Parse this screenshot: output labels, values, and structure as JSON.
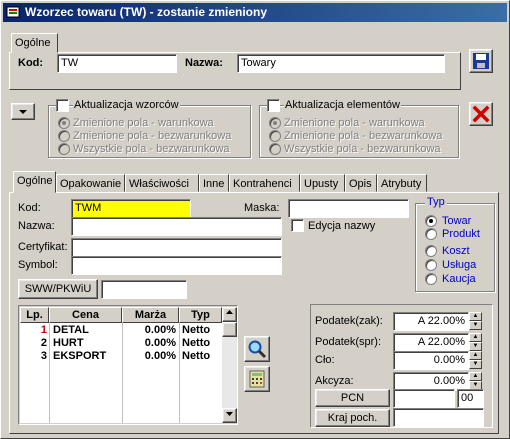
{
  "window": {
    "title": "Wzorzec towaru (TW) - zostanie zmieniony"
  },
  "top": {
    "tab_label": "Ogólne",
    "kod_label": "Kod:",
    "kod_value": "TW",
    "nazwa_label": "Nazwa:",
    "nazwa_value": "Towary"
  },
  "update": {
    "templates_label": "Aktualizacja wzorców",
    "elements_label": "Aktualizacja elementów",
    "opt1": "Zmienione pola - warunkowa",
    "opt2": "Zmienione pola - bezwarunkowa",
    "opt3": "Wszystkie pola - bezwarunkowa"
  },
  "tabs": [
    "Ogólne",
    "Opakowanie",
    "Właściwości",
    "Inne",
    "Kontrahenci",
    "Upusty",
    "Opis",
    "Atrybuty"
  ],
  "general": {
    "kod_label": "Kod:",
    "kod_value": "TWM",
    "maska_label": "Maska:",
    "maska_value": "",
    "nazwa_label": "Nazwa:",
    "nazwa_value": "",
    "edycja_label": "Edycja nazwy",
    "certyfikat_label": "Certyfikat:",
    "symbol_label": "Symbol:",
    "sww_button": "SWW/PKWiU"
  },
  "typ": {
    "title": "Typ",
    "options": [
      "Towar",
      "Produkt",
      "Koszt",
      "Usługa",
      "Kaucja"
    ],
    "selected": "Towar"
  },
  "prices": {
    "headers": [
      "Lp.",
      "Cena",
      "Marża",
      "Typ"
    ],
    "rows": [
      {
        "lp": "1",
        "cena": "DETAL",
        "marza": "0.00%",
        "typ": "Netto"
      },
      {
        "lp": "2",
        "cena": "HURT",
        "marza": "0.00%",
        "typ": "Netto"
      },
      {
        "lp": "3",
        "cena": "EKSPORT",
        "marza": "0.00%",
        "typ": "Netto"
      }
    ]
  },
  "tax": {
    "podatek_zak_label": "Podatek(zak):",
    "podatek_zak_value": "A 22.00%",
    "podatek_spr_label": "Podatek(spr):",
    "podatek_spr_value": "A 22.00%",
    "clo_label": "Cło:",
    "clo_value": "0.00%",
    "akcyza_label": "Akcyza:",
    "akcyza_value": "0.00%",
    "pcn_button": "PCN",
    "pcn_value": "00",
    "kraj_button": "Kraj poch."
  }
}
